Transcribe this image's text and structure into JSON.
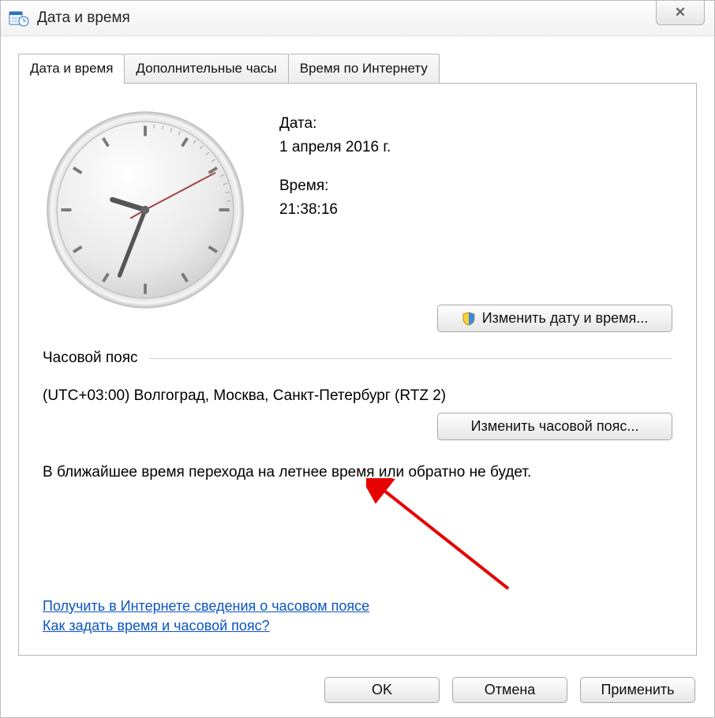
{
  "window": {
    "title": "Дата и время"
  },
  "tabs": [
    "Дата и время",
    "Дополнительные часы",
    "Время по Интернету"
  ],
  "main": {
    "date_label": "Дата:",
    "date_value": "1 апреля 2016 г.",
    "time_label": "Время:",
    "time_value": "21:38:16"
  },
  "timezone": {
    "section_label": "Часовой пояс",
    "value": "(UTC+03:00) Волгоград, Москва, Санкт-Петербург (RTZ 2)",
    "dst_note": "В ближайшее время перехода на летнее время или обратно не будет."
  },
  "buttons": {
    "change_datetime": "Изменить дату и время...",
    "change_timezone": "Изменить часовой пояс...",
    "ok": "OK",
    "cancel": "Отмена",
    "apply": "Применить"
  },
  "links": [
    "Получить в Интернете сведения о часовом поясе",
    "Как задать время и часовой пояс?"
  ]
}
